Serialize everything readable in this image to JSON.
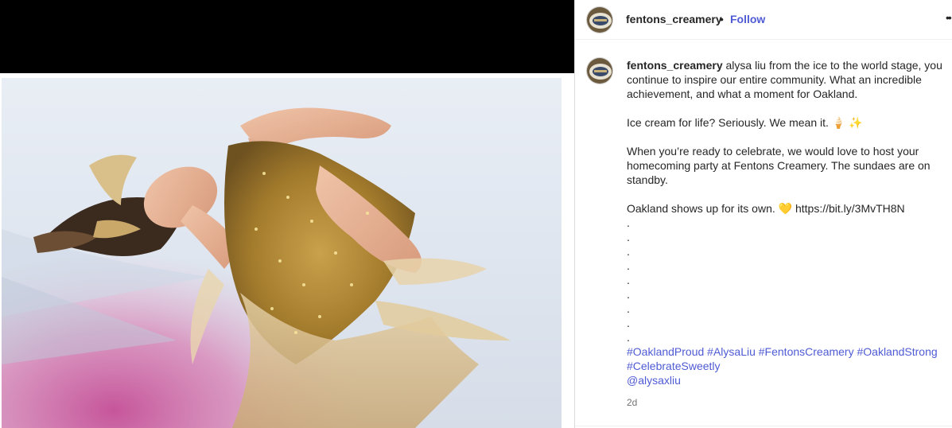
{
  "post": {
    "username": "fentons_creamery",
    "separator": "•",
    "follow_label": "Follow",
    "more_label": "••",
    "caption": {
      "username": "fentons_creamery",
      "line1": "alysa liu from the ice to the world stage, you continue to inspire our entire community. What an incredible achievement, and what a moment for Oakland.",
      "line2": "Ice cream for life? Seriously. We mean it. 🍦 ✨",
      "line3": "When you’re ready to celebrate, we would love to host your homecoming party at Fentons Creamery. The sundaes are on standby.",
      "line4_text": "Oakland shows up for its own. 💛 https://bit.ly/3MvTH8N",
      "dots": [
        ".",
        ".",
        ".",
        ".",
        ".",
        ".",
        ".",
        ".",
        "."
      ],
      "hashtags": "#OaklandProud #AlysaLiu #FentonsCreamery #OaklandStrong #CelebrateSweetly",
      "mention": "@alysaxliu"
    },
    "time": "2d"
  },
  "icons": {
    "avatar": "avatar-icon",
    "more": "more-icon"
  },
  "colors": {
    "link": "#4f5bd5",
    "text": "#262626",
    "muted": "#737373",
    "topbar": "#000000"
  }
}
